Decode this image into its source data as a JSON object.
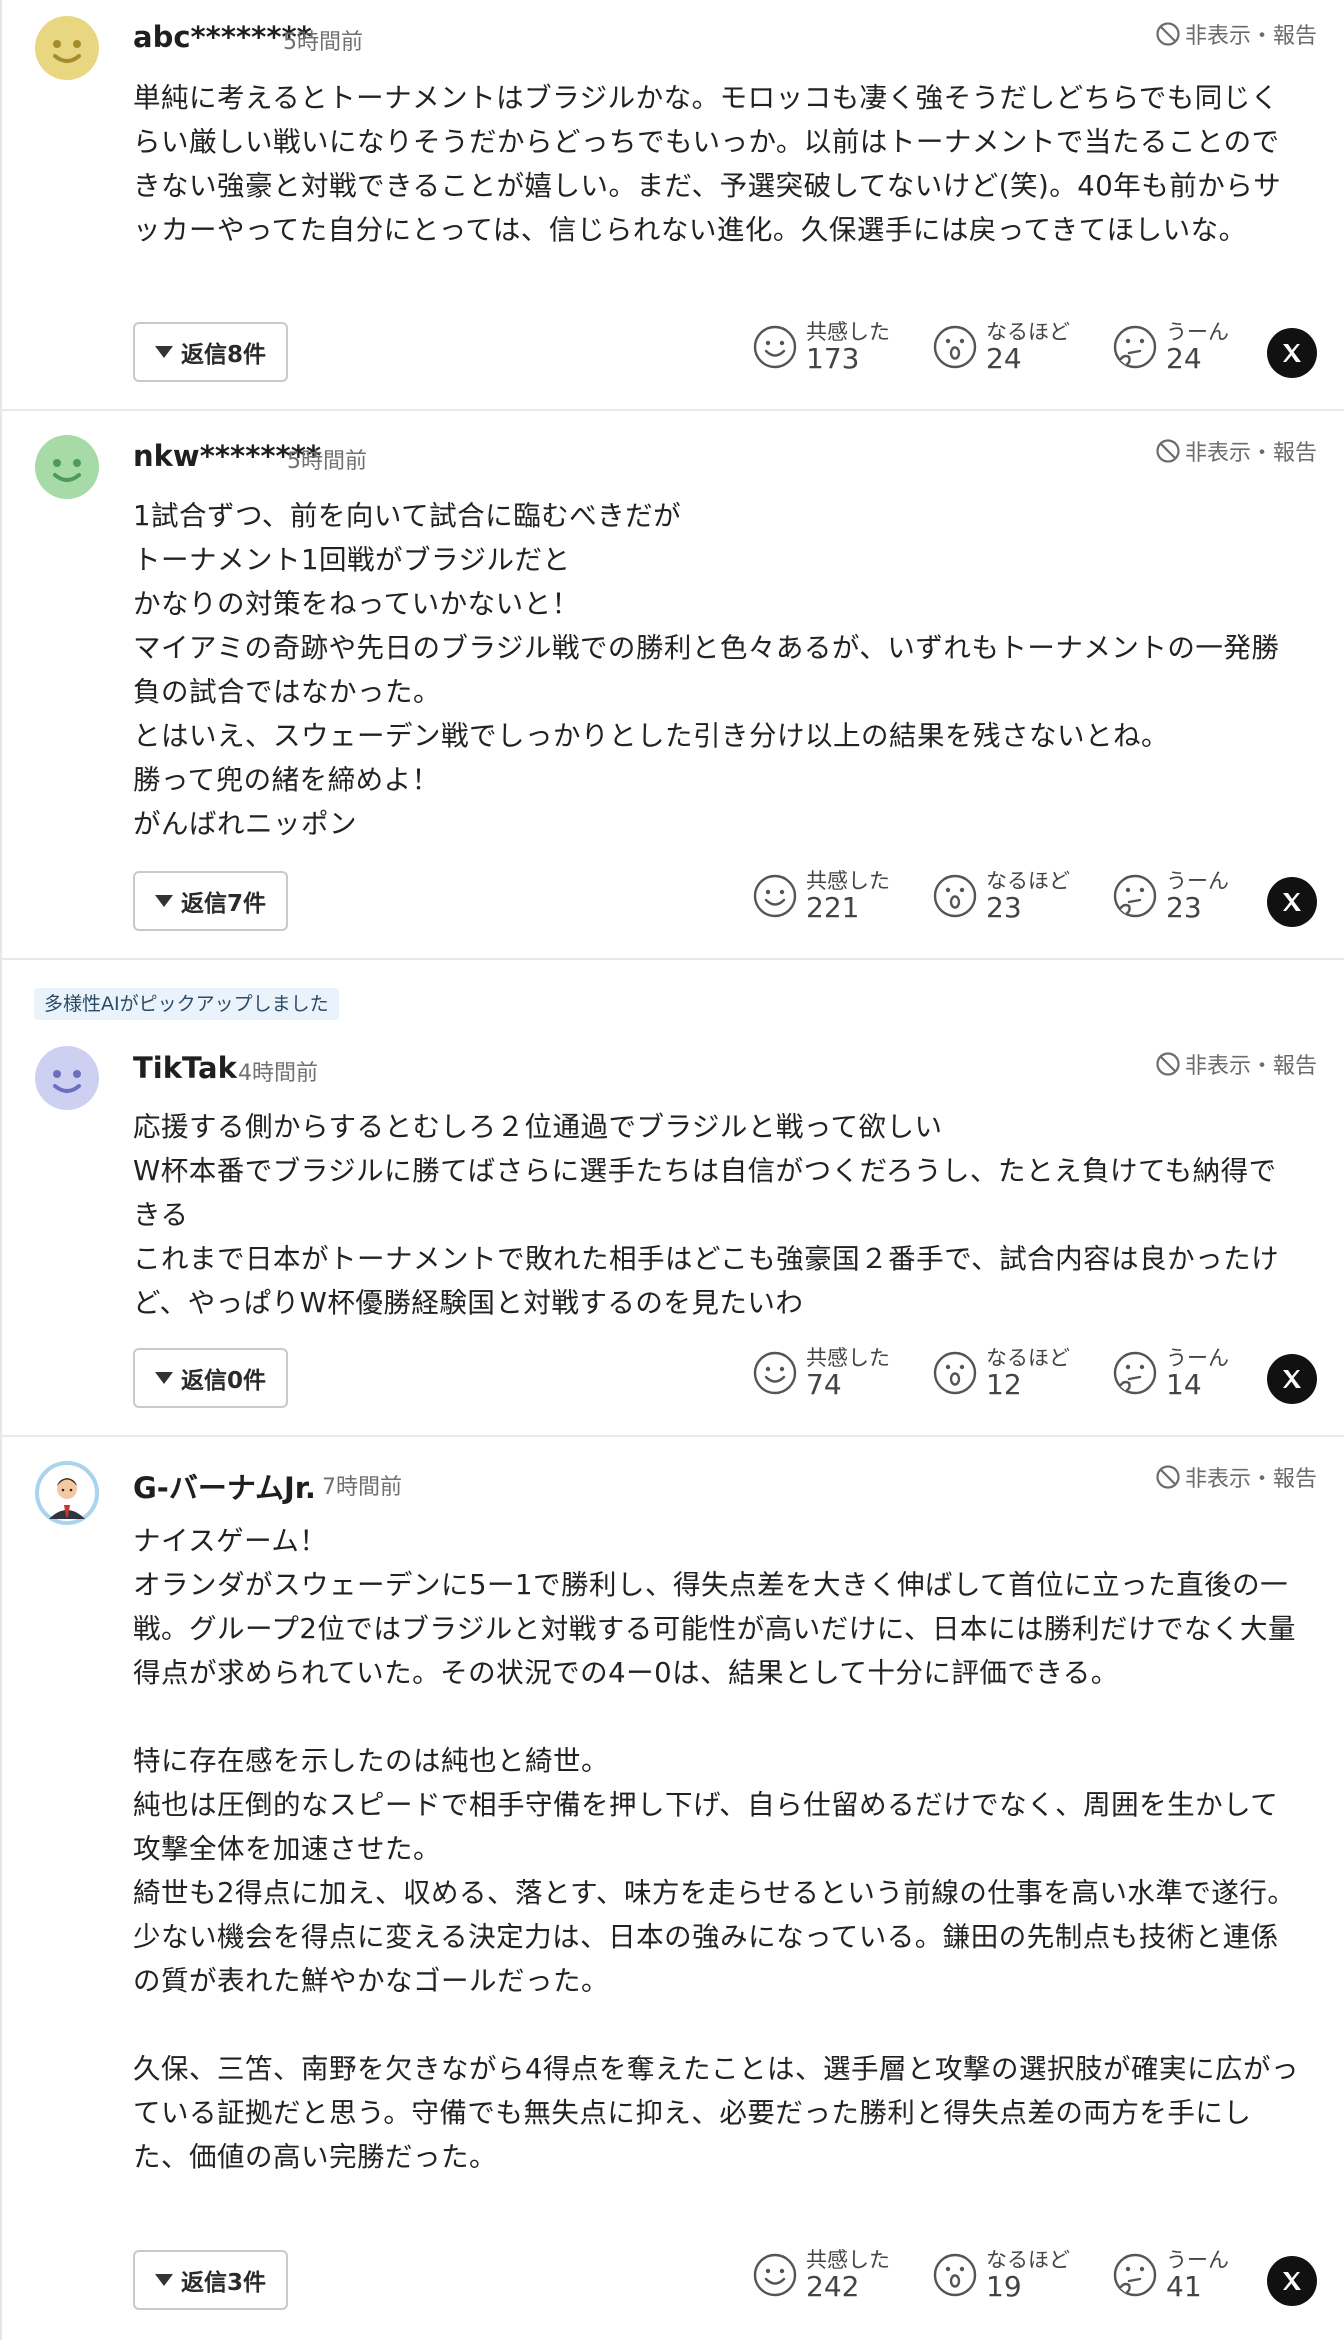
{
  "hide_report_label": "非表示・報告",
  "reply_prefix": "返信",
  "reaction_labels": {
    "empathy": "共感した",
    "naruhodo": "なるほど",
    "uun": "うーん"
  },
  "ai_pick_label": "多様性AIがピックアップしました",
  "comments": [
    {
      "username": "abc********",
      "time": "5時間前",
      "avatar": "smiley-yellow-avatar",
      "avatar_color": "#e8d680",
      "body": [
        "単純に考えるとトーナメントはブラジルかな。モロッコも凄く強そうだしどちらでも同じくらい厳しい戦いになりそうだからどっちでもいっか。以前はトーナメントで当たることのできない強豪と対戦できることが嬉しい。まだ、予選突破してないけど(笑)。40年も前からサッカーやってた自分にとっては、信じられない進化。久保選手には戻ってきてほしいな。"
      ],
      "reply_count": "8件",
      "empathy": "173",
      "naruhodo": "24",
      "uun": "24"
    },
    {
      "username": "nkw********",
      "time": "5時間前",
      "avatar": "smiley-green-avatar",
      "avatar_color": "#a6dba8",
      "body": [
        "1試合ずつ、前を向いて試合に臨むべきだが",
        "トーナメント1回戦がブラジルだと",
        "かなりの対策をねっていかないと！",
        "マイアミの奇跡や先日のブラジル戦での勝利と色々あるが、いずれもトーナメントの一発勝負の試合ではなかった。",
        "とはいえ、スウェーデン戦でしっかりとした引き分け以上の結果を残さないとね。",
        "勝って兜の緒を締めよ！",
        "がんばれニッポン"
      ],
      "reply_count": "7件",
      "empathy": "221",
      "naruhodo": "23",
      "uun": "23"
    },
    {
      "username": "TikTak",
      "time": "4時間前",
      "avatar": "smiley-lavender-avatar",
      "avatar_color": "#cdd0f1",
      "body": [
        "応援する側からするとむしろ２位通過でブラジルと戦って欲しい",
        "W杯本番でブラジルに勝てばさらに選手たちは自信がつくだろうし、たとえ負けても納得できる",
        "これまで日本がトーナメントで敗れた相手はどこも強豪国２番手で、試合内容は良かったけど、やっぱりW杯優勝経験国と対戦するのを見たいわ"
      ],
      "reply_count": "0件",
      "empathy": "74",
      "naruhodo": "12",
      "uun": "14"
    },
    {
      "username": "G-バーナムJr.",
      "time": "7時間前",
      "avatar": "businessman-avatar",
      "avatar_color": "#a9d3ee",
      "body": [
        "ナイスゲーム！",
        "オランダがスウェーデンに5ー1で勝利し、得失点差を大きく伸ばして首位に立った直後の一戦。グループ2位ではブラジルと対戦する可能性が高いだけに、日本には勝利だけでなく大量得点が求められていた。その状況での4ー0は、結果として十分に評価できる。",
        "",
        "特に存在感を示したのは純也と綺世。",
        "純也は圧倒的なスピードで相手守備を押し下げ、自ら仕留めるだけでなく、周囲を生かして攻撃全体を加速させた。",
        "綺世も2得点に加え、収める、落とす、味方を走らせるという前線の仕事を高い水準で遂行。少ない機会を得点に変える決定力は、日本の強みになっている。鎌田の先制点も技術と連係の質が表れた鮮やかなゴールだった。",
        "",
        "久保、三笘、南野を欠きながら4得点を奪えたことは、選手層と攻撃の選択肢が確実に広がっている証拠だと思う。守備でも無失点に抑え、必要だった勝利と得失点差の両方を手にした、価値の高い完勝だった。"
      ],
      "reply_count": "3件",
      "empathy": "242",
      "naruhodo": "19",
      "uun": "41"
    }
  ]
}
